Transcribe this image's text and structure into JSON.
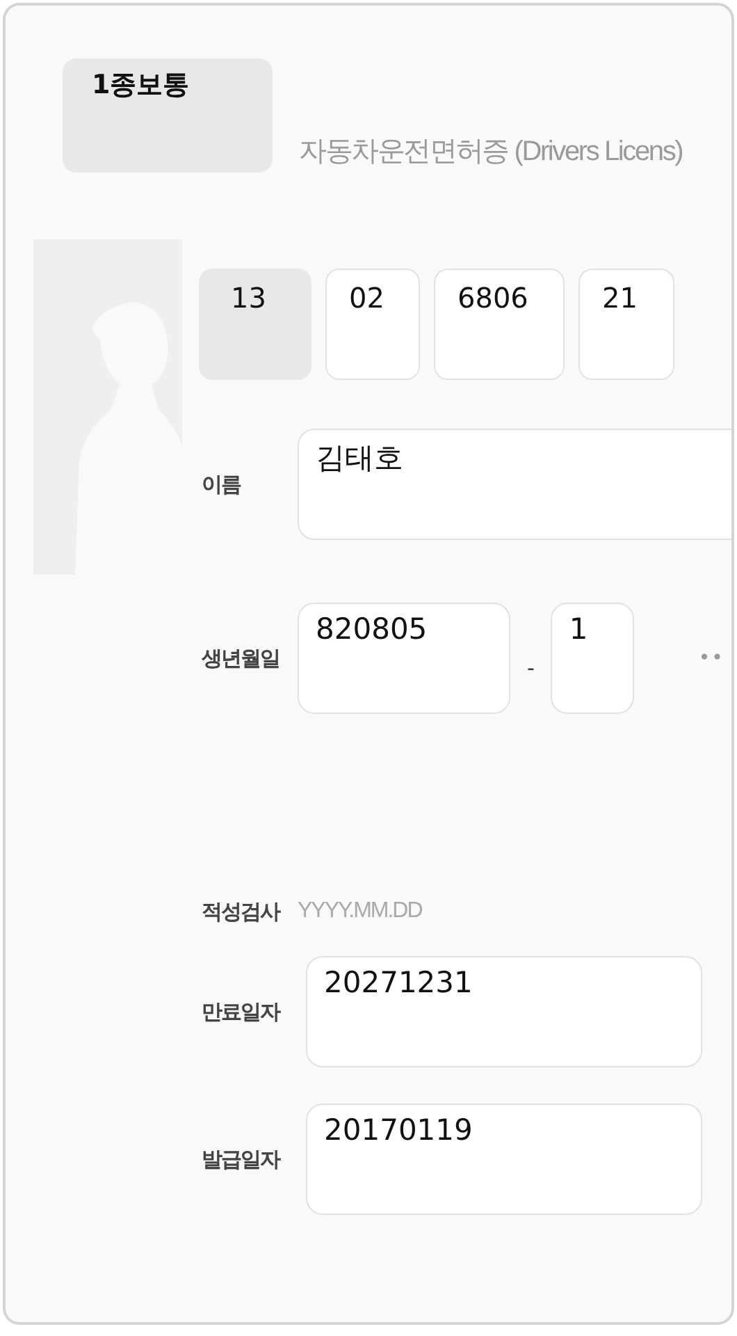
{
  "license_type": "1종보통",
  "title": "자동차운전면허증 (Drivers Licens)",
  "license_number": [
    {
      "value": "13",
      "disabled": true
    },
    {
      "value": "02",
      "disabled": false
    },
    {
      "value": "6806",
      "disabled": false
    },
    {
      "value": "21",
      "disabled": false
    }
  ],
  "fields": [
    {
      "kind": "name",
      "label": "이름",
      "value": "김태호"
    },
    {
      "kind": "resident",
      "label": "생년월일",
      "value": "820805",
      "separator": "-",
      "second": "1",
      "masked": "••"
    },
    {
      "kind": "empty",
      "label": "적성검사",
      "placeholder": "YYYY.MM.DD"
    },
    {
      "kind": "date",
      "label": "만료일자",
      "value": "20271231"
    },
    {
      "kind": "date",
      "label": "발급일자",
      "value": "20170119"
    }
  ]
}
